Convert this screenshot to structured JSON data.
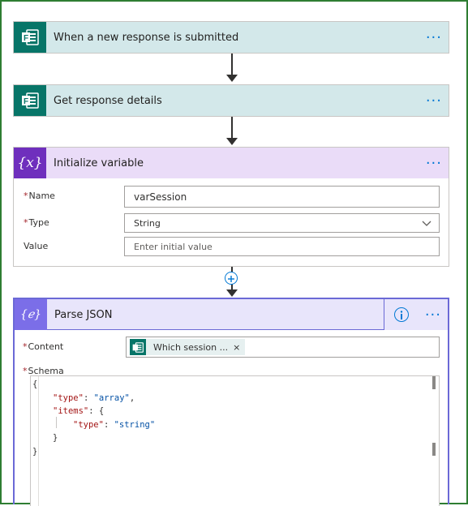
{
  "steps": {
    "trigger": {
      "title": "When a new response is submitted",
      "icon": "forms-icon",
      "more": "···"
    },
    "get_details": {
      "title": "Get response details",
      "icon": "forms-icon",
      "more": "···"
    },
    "init_var": {
      "title": "Initialize variable",
      "icon": "variable-icon",
      "icon_glyph": "{x}",
      "more": "···",
      "fields": {
        "name_label": "Name",
        "name_value": "varSession",
        "type_label": "Type",
        "type_value": "String",
        "value_label": "Value",
        "value_placeholder": "Enter initial value"
      }
    },
    "parse_json": {
      "title": "Parse JSON",
      "icon": "json-icon",
      "icon_glyph": "{ℯ}",
      "more": "···",
      "fields": {
        "content_label": "Content",
        "content_token": "Which session ...",
        "schema_label": "Schema"
      },
      "schema_lines": {
        "l1": "{",
        "l2_key": "\"type\"",
        "l2_val": "\"array\"",
        "l3_key": "\"items\"",
        "l4_key": "\"type\"",
        "l4_val": "\"string\"",
        "l5": "}",
        "l6": "}"
      }
    }
  },
  "required_marker": "*",
  "colors": {
    "forms_teal": "#077568",
    "variable_purple": "#6f2fbd",
    "json_purple": "#7b6ee8",
    "link_blue": "#0078d4",
    "frame_green": "#2e7d32"
  }
}
